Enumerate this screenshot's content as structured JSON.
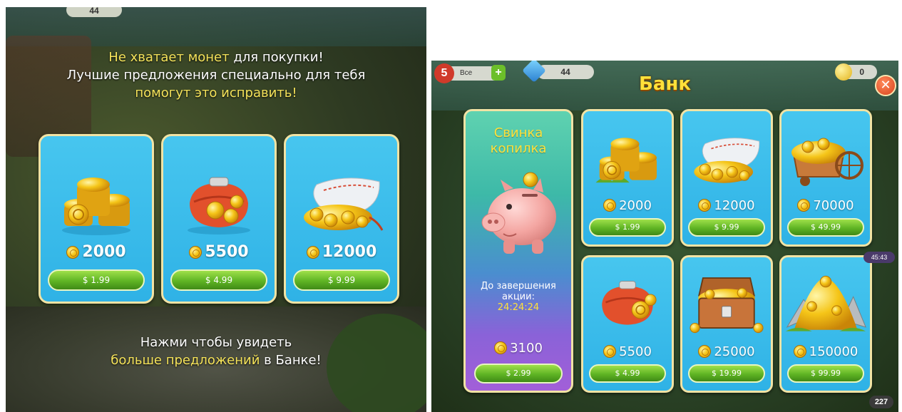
{
  "left_popup": {
    "top_badge": "44",
    "message_top": [
      [
        {
          "t": "Не хватает монет",
          "hl": true
        },
        {
          "t": " для покупки!",
          "hl": false
        }
      ],
      [
        {
          "t": "Лучшие предложения специально для тебя",
          "hl": false
        }
      ],
      [
        {
          "t": "помогут это исправить!",
          "hl": true
        }
      ]
    ],
    "message_bottom": [
      [
        {
          "t": "Нажми чтобы увидеть",
          "hl": false
        }
      ],
      [
        {
          "t": "больше предложений",
          "hl": true
        },
        {
          "t": " в Банке!",
          "hl": false
        }
      ]
    ],
    "offers": [
      {
        "amount": "2000",
        "price": "$ 1.99",
        "icon": "coin-stack-icon"
      },
      {
        "amount": "5500",
        "price": "$ 4.99",
        "icon": "coin-purse-icon"
      },
      {
        "amount": "12000",
        "price": "$ 9.99",
        "icon": "coin-sack-icon"
      }
    ]
  },
  "bank": {
    "title": "Банк",
    "close_icon": "close-icon",
    "hud": {
      "level": "5",
      "level_label": "Все",
      "gems": "44",
      "coins": "0",
      "timer": "45:43",
      "count": "227"
    },
    "piggy": {
      "title_line1": "Свинка",
      "title_line2": "копилка",
      "promo_line1": "До завершения",
      "promo_line2": "акции:",
      "promo_time": "24:24:24",
      "amount": "3100",
      "price": "$ 2.99",
      "icon": "piggy-bank-icon"
    },
    "offers": [
      {
        "amount": "2000",
        "price": "$ 1.99",
        "icon": "coin-stack-icon"
      },
      {
        "amount": "12000",
        "price": "$ 9.99",
        "icon": "coin-sack-icon"
      },
      {
        "amount": "70000",
        "price": "$ 49.99",
        "icon": "coin-cart-icon"
      },
      {
        "amount": "5500",
        "price": "$ 4.99",
        "icon": "coin-purse-icon"
      },
      {
        "amount": "25000",
        "price": "$ 19.99",
        "icon": "treasure-chest-icon"
      },
      {
        "amount": "150000",
        "price": "$ 99.99",
        "icon": "coin-mountain-icon"
      }
    ]
  },
  "colors": {
    "card_blue": "#2fb2e6",
    "card_border": "#f1e3a4",
    "button_green": "#5fb424",
    "highlight_yellow": "#f5e35a",
    "title_yellow": "#ffe13a",
    "close_red": "#d8431e"
  }
}
